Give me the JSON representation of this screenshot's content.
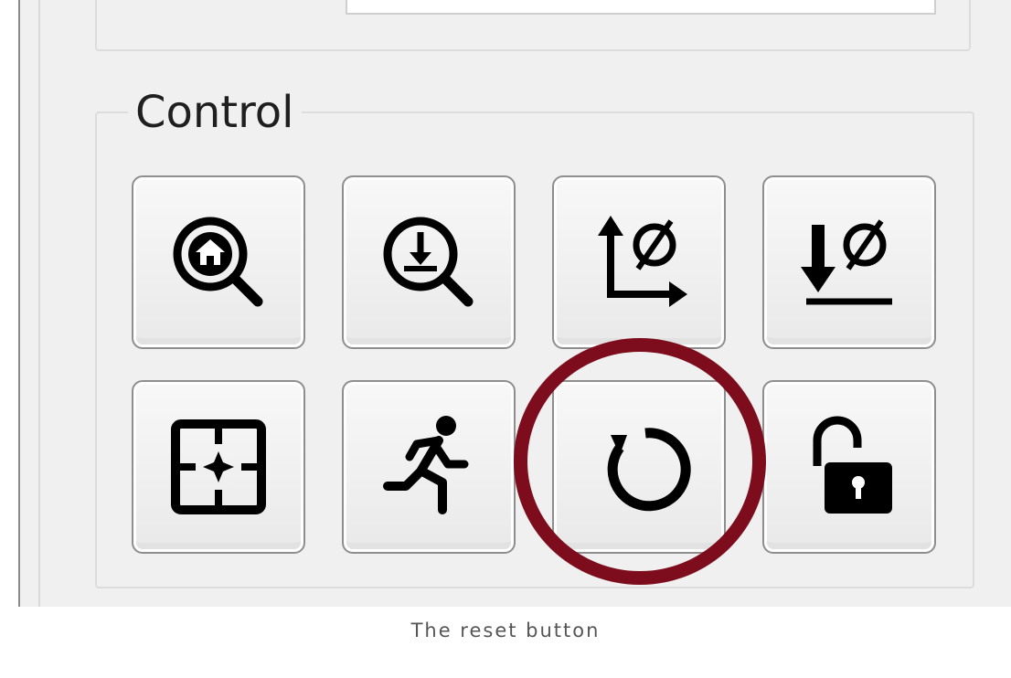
{
  "control_panel": {
    "title": "Control",
    "buttons": [
      {
        "id": "home",
        "icon": "zoom-home-icon"
      },
      {
        "id": "zoom-down",
        "icon": "zoom-down-icon"
      },
      {
        "id": "up-zero",
        "icon": "axis-up-zero-icon"
      },
      {
        "id": "down-zero",
        "icon": "down-zero-icon"
      },
      {
        "id": "center",
        "icon": "crosshair-frame-icon"
      },
      {
        "id": "run",
        "icon": "running-person-icon"
      },
      {
        "id": "reset",
        "icon": "reset-icon"
      },
      {
        "id": "lock",
        "icon": "unlock-icon"
      }
    ]
  },
  "highlight": {
    "target": "reset",
    "color": "#7d0d1c"
  },
  "caption": "The reset button"
}
